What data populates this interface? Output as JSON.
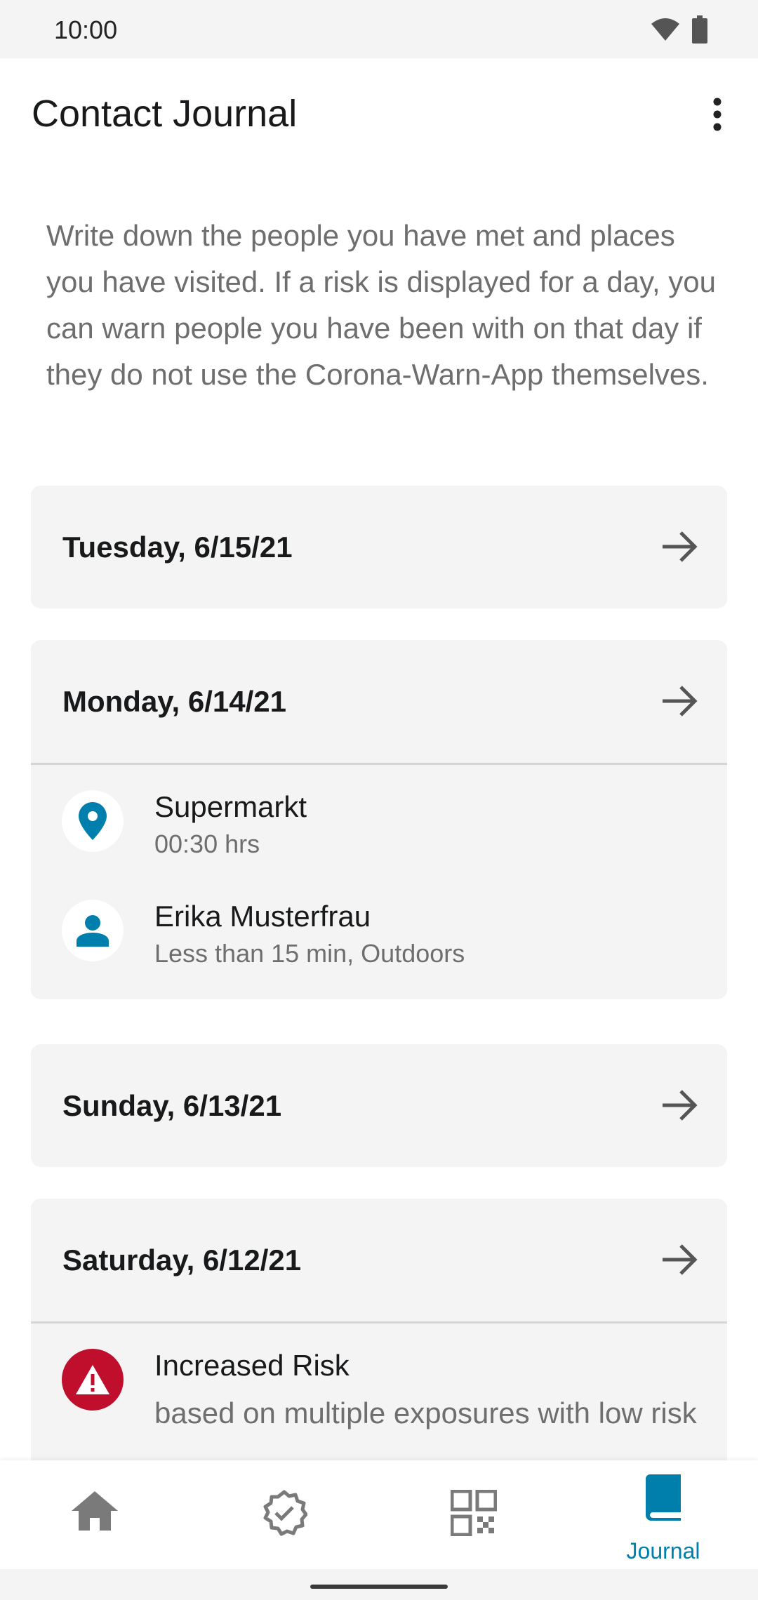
{
  "status_bar": {
    "time": "10:00"
  },
  "app_bar": {
    "title": "Contact Journal"
  },
  "intro_text": "Write down the people you have met and places you have visited. If a risk is displayed for a day, you can warn people you have been with on that day if they do not use the Corona-Warn-App themselves.",
  "days": [
    {
      "date": "Tuesday, 6/15/21",
      "entries": []
    },
    {
      "date": "Monday, 6/14/21",
      "entries": [
        {
          "icon": "location-pin-icon",
          "name": "Supermarkt",
          "detail": "00:30 hrs"
        },
        {
          "icon": "person-icon",
          "name": "Erika Musterfrau",
          "detail": "Less than 15 min, Outdoors"
        }
      ]
    },
    {
      "date": "Sunday, 6/13/21",
      "entries": []
    },
    {
      "date": "Saturday, 6/12/21",
      "risk": {
        "icon": "warning-icon",
        "title": "Increased Risk",
        "detail": "based on multiple exposures with low risk"
      }
    }
  ],
  "bottom_nav": {
    "items": [
      {
        "icon": "home-icon",
        "label": ""
      },
      {
        "icon": "certificate-check-icon",
        "label": ""
      },
      {
        "icon": "qr-code-icon",
        "label": ""
      },
      {
        "icon": "journal-book-icon",
        "label": "Journal"
      }
    ]
  },
  "colors": {
    "accent": "#007fad",
    "risk_red": "#c00f2d",
    "card_bg": "#f4f4f4",
    "muted_text": "#6e6e6e"
  }
}
